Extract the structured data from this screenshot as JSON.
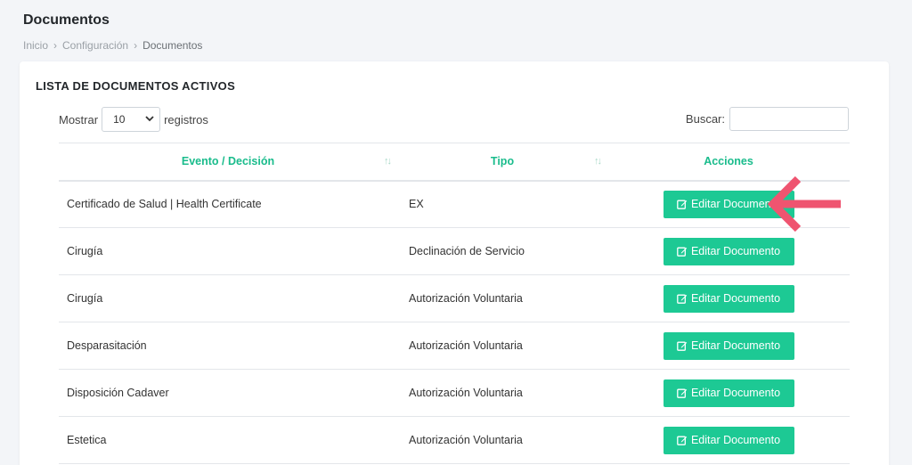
{
  "header": {
    "title": "Documentos",
    "breadcrumb": [
      "Inicio",
      "Configuración",
      "Documentos"
    ]
  },
  "card": {
    "title": "LISTA DE DOCUMENTOS ACTIVOS",
    "show_label": "Mostrar",
    "show_value": "10",
    "records_label": "registros",
    "search_label": "Buscar:",
    "search_value": ""
  },
  "table": {
    "columns": [
      "Evento / Decisión",
      "Tipo",
      "Acciones"
    ],
    "rows": [
      {
        "event": "Certificado de Salud | Health Certificate",
        "type": "EX",
        "action": "Editar Documento"
      },
      {
        "event": "Cirugía",
        "type": "Declinación de Servicio",
        "action": "Editar Documento"
      },
      {
        "event": "Cirugía",
        "type": "Autorización Voluntaria",
        "action": "Editar Documento"
      },
      {
        "event": "Desparasitación",
        "type": "Autorización Voluntaria",
        "action": "Editar Documento"
      },
      {
        "event": "Disposición Cadaver",
        "type": "Autorización Voluntaria",
        "action": "Editar Documento"
      },
      {
        "event": "Estetica",
        "type": "Autorización Voluntaria",
        "action": "Editar Documento"
      }
    ]
  },
  "colors": {
    "accent": "#1dc994",
    "header_text": "#1abc8c",
    "annotation_arrow": "#ef5470"
  }
}
